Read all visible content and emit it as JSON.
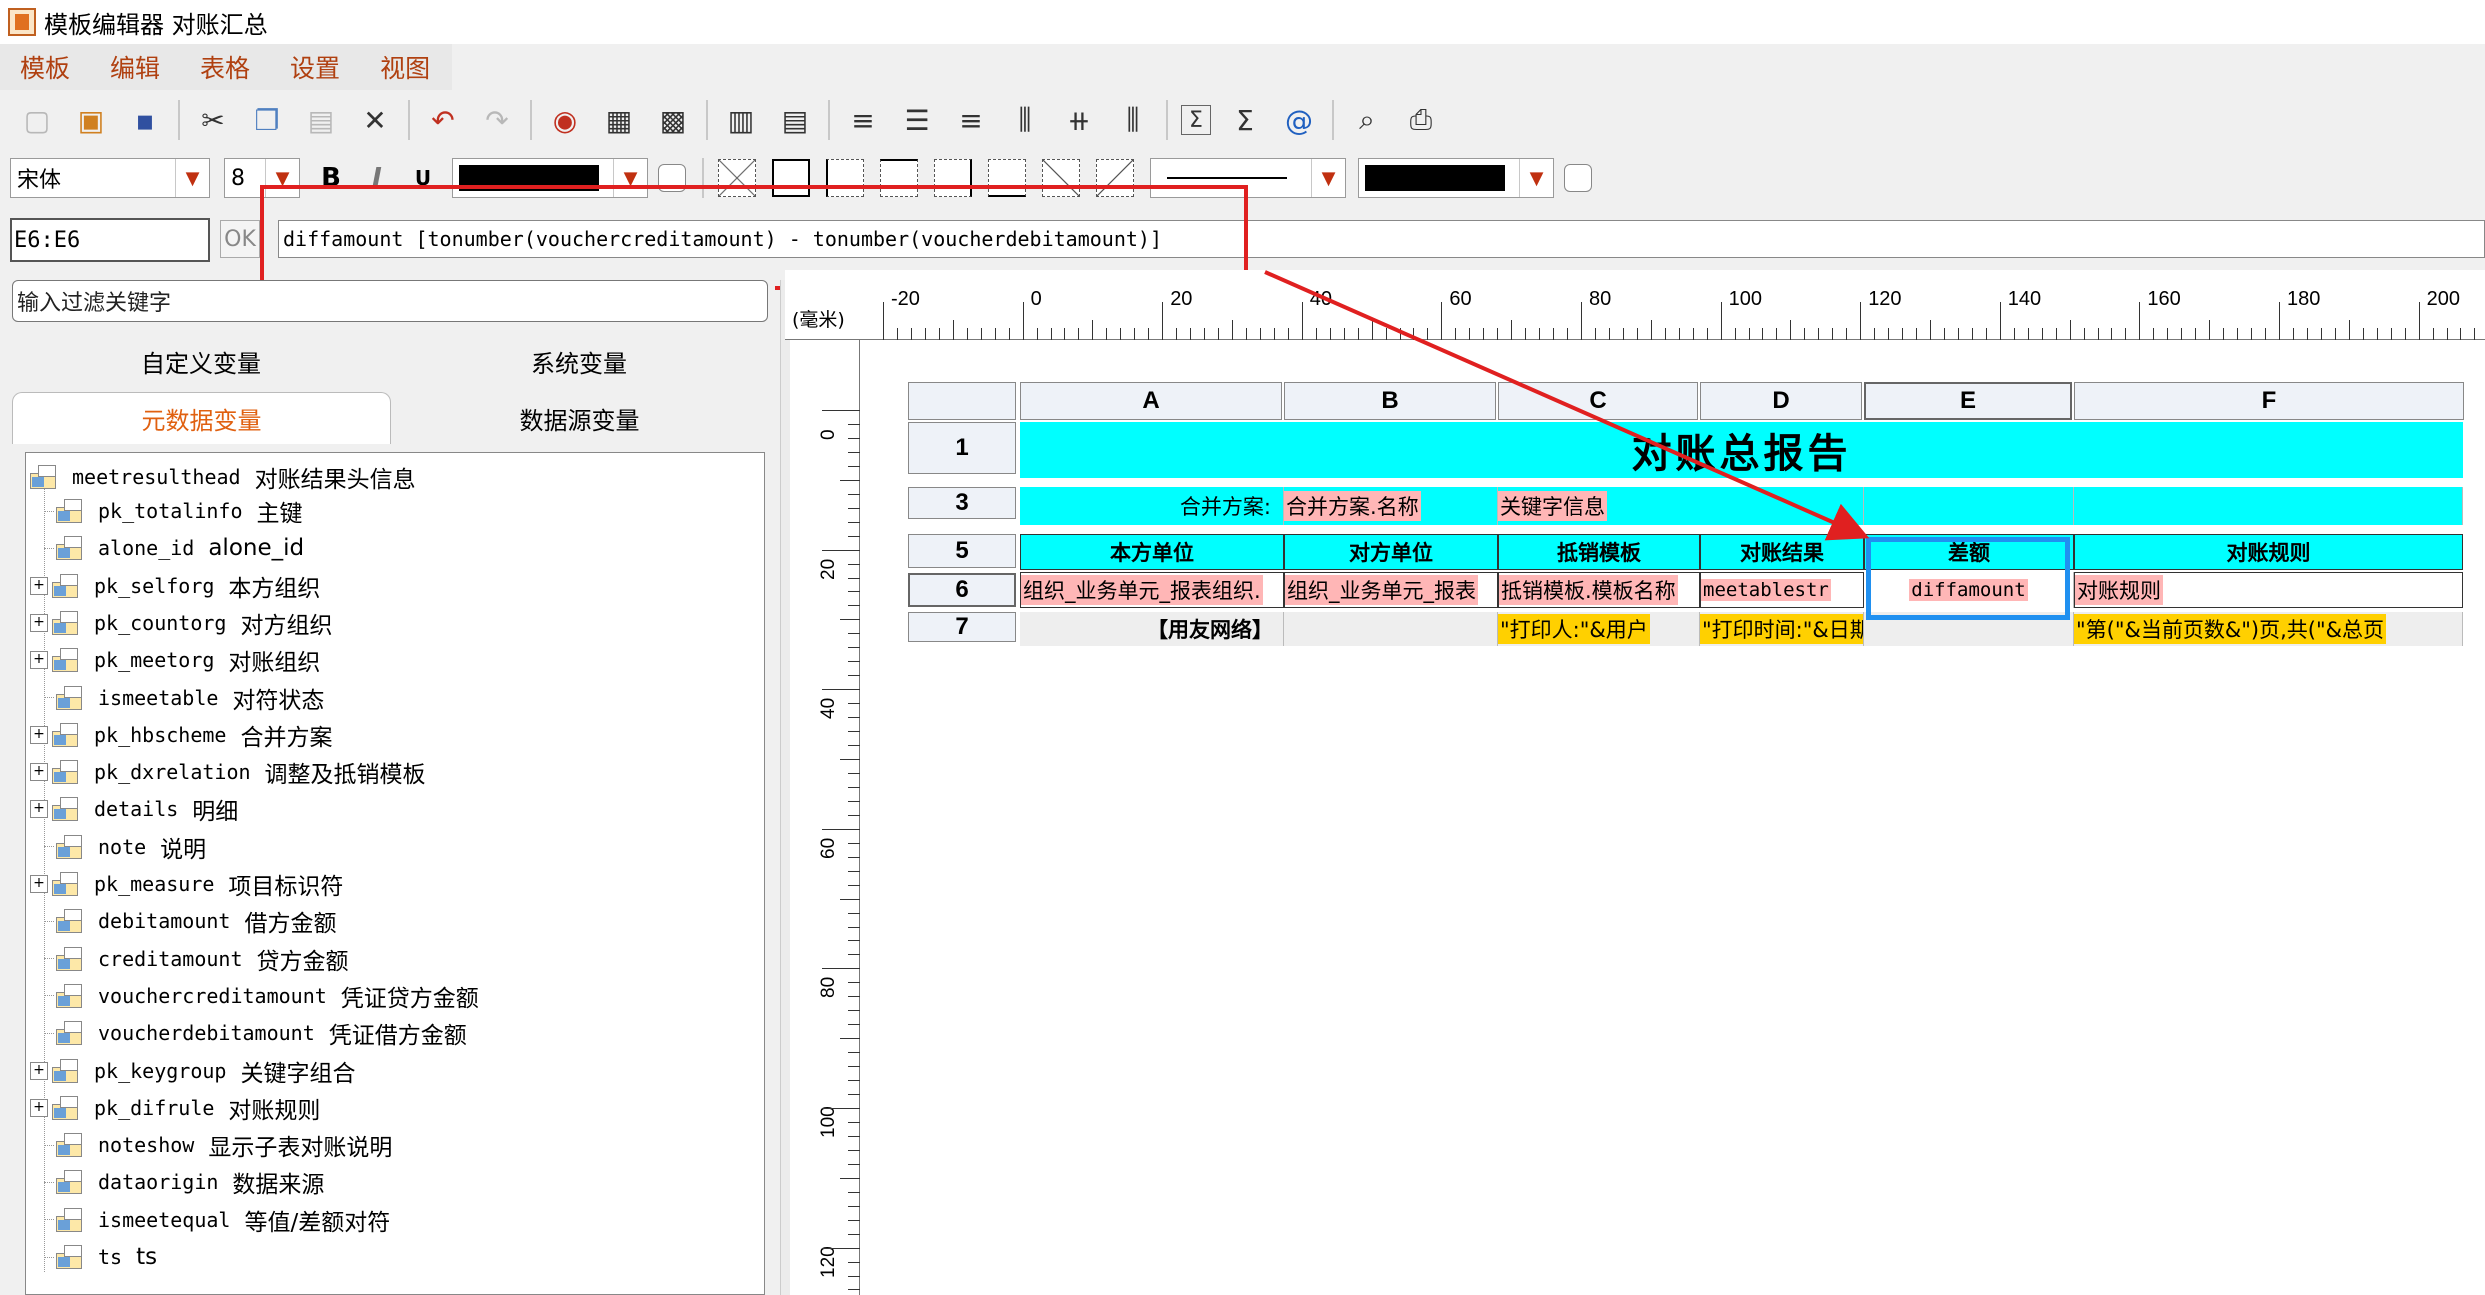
{
  "window": {
    "title": "模板编辑器 对账汇总"
  },
  "menu": [
    "模板",
    "编辑",
    "表格",
    "设置",
    "视图"
  ],
  "toolbar": {
    "icons": [
      "new-file-icon",
      "open-icon",
      "save-icon",
      "cut-icon",
      "copy-icon",
      "paste-icon",
      "delete-icon",
      "undo-icon",
      "redo-icon",
      "print-stamp-icon",
      "table-icon",
      "grid-icon",
      "insert-column-icon",
      "insert-row-icon",
      "align-left-icon",
      "align-center-icon",
      "align-right-icon",
      "valign-top-icon",
      "valign-middle-icon",
      "valign-bottom-icon",
      "formula-icon",
      "sum-icon",
      "at-icon",
      "preview-icon",
      "printer-icon"
    ],
    "formula_symbol": "Σ",
    "sum_symbol": "Σ",
    "at_symbol": "@"
  },
  "format": {
    "font": "宋体",
    "size": "8",
    "bold": "B",
    "italic": "I",
    "underline": "U",
    "text_color": "#000000",
    "bg_color": "#000000"
  },
  "formula_bar": {
    "cell_ref": "E6:E6",
    "ok_label": "OK",
    "expression": "diffamount  [tonumber(vouchercreditamount) - tonumber(voucherdebitamount)]"
  },
  "left_panel": {
    "filter_placeholder": "输入过滤关键字",
    "tabs_row1": [
      "自定义变量",
      "系统变量"
    ],
    "tabs_row2": [
      "元数据变量",
      "数据源变量"
    ],
    "active_tab": "元数据变量",
    "tree": {
      "root": {
        "code": "meetresulthead",
        "label": "对账结果头信息"
      },
      "children": [
        {
          "code": "pk_totalinfo",
          "label": "主键",
          "expandable": false
        },
        {
          "code": "alone_id",
          "label": "alone_id",
          "expandable": false
        },
        {
          "code": "pk_selforg",
          "label": "本方组织",
          "expandable": true
        },
        {
          "code": "pk_countorg",
          "label": "对方组织",
          "expandable": true
        },
        {
          "code": "pk_meetorg",
          "label": "对账组织",
          "expandable": true
        },
        {
          "code": "ismeetable",
          "label": "对符状态",
          "expandable": false
        },
        {
          "code": "pk_hbscheme",
          "label": "合并方案",
          "expandable": true
        },
        {
          "code": "pk_dxrelation",
          "label": "调整及抵销模板",
          "expandable": true
        },
        {
          "code": "details",
          "label": "明细",
          "expandable": true
        },
        {
          "code": "note",
          "label": "说明",
          "expandable": false
        },
        {
          "code": "pk_measure",
          "label": "项目标识符",
          "expandable": true
        },
        {
          "code": "debitamount",
          "label": "借方金额",
          "expandable": false
        },
        {
          "code": "creditamount",
          "label": "贷方金额",
          "expandable": false
        },
        {
          "code": "vouchercreditamount",
          "label": "凭证贷方金额",
          "expandable": false
        },
        {
          "code": "voucherdebitamount",
          "label": "凭证借方金额",
          "expandable": false
        },
        {
          "code": "pk_keygroup",
          "label": "关键字组合",
          "expandable": true
        },
        {
          "code": "pk_difrule",
          "label": "对账规则",
          "expandable": true
        },
        {
          "code": "noteshow",
          "label": "显示子表对账说明",
          "expandable": false
        },
        {
          "code": "dataorigin",
          "label": "数据来源",
          "expandable": false
        },
        {
          "code": "ismeetequal",
          "label": "等值/差额对符",
          "expandable": false
        },
        {
          "code": "ts",
          "label": "ts",
          "expandable": false
        }
      ]
    }
  },
  "ruler": {
    "unit": "(毫米)",
    "h_labels": [
      "-20",
      "0",
      "20",
      "40",
      "60",
      "80",
      "100",
      "120",
      "140",
      "160",
      "180",
      "200"
    ],
    "v_labels": [
      "0",
      "20",
      "40",
      "60",
      "80",
      "100",
      "120"
    ]
  },
  "sheet": {
    "columns": [
      "A",
      "B",
      "C",
      "D",
      "E",
      "F"
    ],
    "rows": [
      "1",
      "3",
      "5",
      "6",
      "7"
    ],
    "title": "对账总报告",
    "row3": {
      "label": "合并方案:",
      "scheme_name": "合并方案.名称",
      "keyword_info": "关键字信息"
    },
    "row5": [
      "本方单位",
      "对方单位",
      "抵销模板",
      "对账结果",
      "差额",
      "对账规则"
    ],
    "row6": [
      "组织_业务单元_报表组织.",
      "组织_业务单元_报表",
      "抵销模板.模板名称",
      "meetablestr",
      "diffamount",
      "对账规则"
    ],
    "row7": {
      "a": "【用友网络】",
      "c": "\"打印人:\"&用户",
      "d": "\"打印时间:\"&日期",
      "f": "\"第(\"&当前页数&\")页,共(\"&总页"
    }
  }
}
